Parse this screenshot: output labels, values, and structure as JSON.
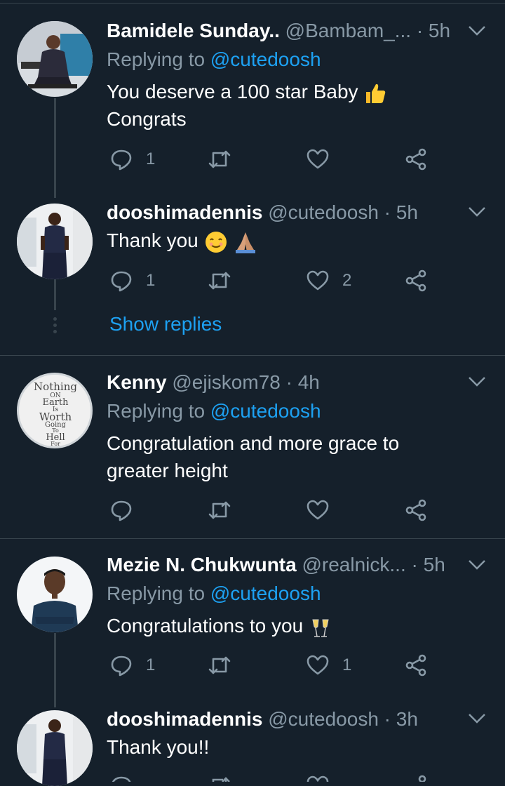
{
  "tweets": [
    {
      "name": "Bamidele Sunday..",
      "handle": "@Bambam_...",
      "time": "· 5h",
      "replying_prefix": "Replying to",
      "replying_to": "@cutedoosh",
      "text": "You deserve a 100 star Baby",
      "text2": "Congrats",
      "reply_count": "1",
      "retweet_count": "",
      "like_count": ""
    },
    {
      "name": "dooshimadennis",
      "handle": "@cutedoosh",
      "time": "· 5h",
      "text": "Thank you",
      "reply_count": "1",
      "retweet_count": "",
      "like_count": "2"
    },
    {
      "name": "Kenny",
      "handle": "@ejiskom78",
      "time": "· 4h",
      "replying_prefix": "Replying to",
      "replying_to": "@cutedoosh",
      "text": "Congratulation and more grace to",
      "text2": "greater height",
      "reply_count": "",
      "retweet_count": "",
      "like_count": ""
    },
    {
      "name": "Mezie N. Chukwunta",
      "handle": "@realnick...",
      "time": "· 5h",
      "replying_prefix": "Replying to",
      "replying_to": "@cutedoosh",
      "text": "Congratulations to you",
      "reply_count": "1",
      "retweet_count": "",
      "like_count": "1"
    },
    {
      "name": "dooshimadennis",
      "handle": "@cutedoosh",
      "time": "· 3h",
      "text": "Thank you!!"
    }
  ],
  "show_replies_label": "Show replies",
  "kenny_avatar_text": [
    "Nothing",
    "ON",
    "Earth",
    "Is",
    "Worth",
    "Going",
    "To",
    "Hell",
    "For"
  ],
  "colors": {
    "background": "#15202b",
    "secondary_text": "#8899a6",
    "link": "#1da1f2",
    "divider": "#38444d"
  },
  "icons": [
    "reply-icon",
    "retweet-icon",
    "like-icon",
    "share-icon",
    "chevron-down-icon"
  ]
}
